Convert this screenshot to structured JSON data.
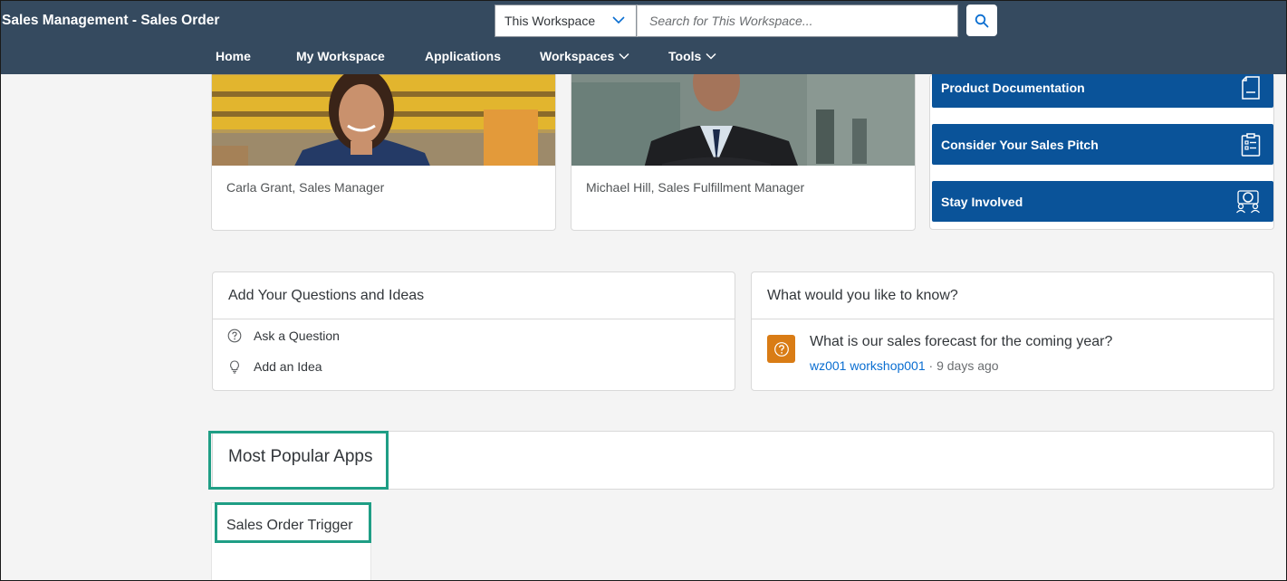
{
  "header": {
    "app_title": "Sales Management - Sales Order",
    "scope_select": {
      "value": "This Workspace"
    },
    "search": {
      "placeholder": "Search for This Workspace..."
    },
    "nav": [
      {
        "label": "Home"
      },
      {
        "label": "My Workspace"
      },
      {
        "label": "Applications"
      },
      {
        "label": "Workspaces"
      },
      {
        "label": "Tools"
      }
    ]
  },
  "people": [
    {
      "caption": "Carla Grant, Sales Manager"
    },
    {
      "caption": "Michael Hill, Sales Fulfillment Manager"
    }
  ],
  "link_tiles": [
    {
      "label": "Product Documentation",
      "icon": "document-icon"
    },
    {
      "label": "Consider Your Sales Pitch",
      "icon": "clipboard-list-icon"
    },
    {
      "label": "Stay Involved",
      "icon": "group-icon"
    }
  ],
  "questions_panel": {
    "title": "Add Your Questions and Ideas",
    "actions": [
      {
        "label": "Ask a Question",
        "icon": "question-icon"
      },
      {
        "label": "Add an Idea",
        "icon": "lightbulb-icon"
      }
    ]
  },
  "know_panel": {
    "title": "What would you like to know?",
    "question": "What is our sales forecast for the coming year?",
    "author": "wz001 workshop001",
    "separator": " · ",
    "age": "9 days ago"
  },
  "popular": {
    "title": "Most Popular Apps",
    "apps": [
      {
        "title": "Sales Order Trigger"
      }
    ]
  },
  "colors": {
    "header_bg": "#354a5f",
    "tile_blue": "#0a5399",
    "question_badge": "#d97c15",
    "highlight": "#1f9e85",
    "link": "#0a6ed1"
  }
}
